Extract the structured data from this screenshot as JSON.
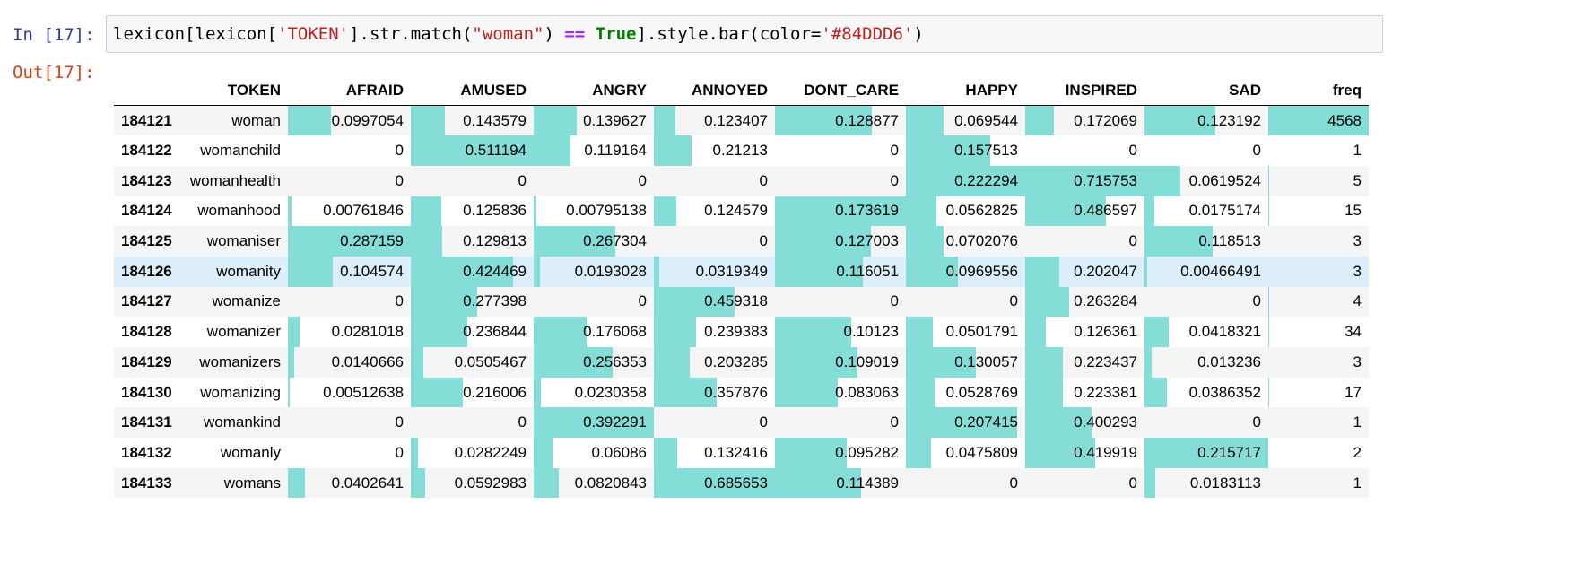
{
  "prompt_in": "In [17]:",
  "prompt_out": "Out[17]:",
  "code": {
    "p1": "lexicon[lexicon[",
    "s1": "'TOKEN'",
    "p2": "].str.match(",
    "s2": "\"woman\"",
    "p3": ") ",
    "op": "==",
    "p4": " ",
    "kw": "True",
    "p5": "].style.bar(color=",
    "s3": "'#84DDD6'",
    "p6": ")"
  },
  "bar_color": "#84DDD6",
  "highlight_row_index": 5,
  "table": {
    "columns": [
      "TOKEN",
      "AFRAID",
      "AMUSED",
      "ANGRY",
      "ANNOYED",
      "DONT_CARE",
      "HAPPY",
      "INSPIRED",
      "SAD",
      "freq"
    ],
    "rows": [
      {
        "index": "184121",
        "values": [
          "woman",
          "0.0997054",
          "0.143579",
          "0.139627",
          "0.123407",
          "0.128877",
          "0.069544",
          "0.172069",
          "0.123192",
          "4568"
        ]
      },
      {
        "index": "184122",
        "values": [
          "womanchild",
          "0",
          "0.511194",
          "0.119164",
          "0.21213",
          "0",
          "0.157513",
          "0",
          "0",
          "1"
        ]
      },
      {
        "index": "184123",
        "values": [
          "womanhealth",
          "0",
          "0",
          "0",
          "0",
          "0",
          "0.222294",
          "0.715753",
          "0.0619524",
          "5"
        ]
      },
      {
        "index": "184124",
        "values": [
          "womanhood",
          "0.00761846",
          "0.125836",
          "0.00795138",
          "0.124579",
          "0.173619",
          "0.0562825",
          "0.486597",
          "0.0175174",
          "15"
        ]
      },
      {
        "index": "184125",
        "values": [
          "womaniser",
          "0.287159",
          "0.129813",
          "0.267304",
          "0",
          "0.127003",
          "0.0702076",
          "0",
          "0.118513",
          "3"
        ]
      },
      {
        "index": "184126",
        "values": [
          "womanity",
          "0.104574",
          "0.424469",
          "0.0193028",
          "0.0319349",
          "0.116051",
          "0.0969556",
          "0.202047",
          "0.00466491",
          "3"
        ]
      },
      {
        "index": "184127",
        "values": [
          "womanize",
          "0",
          "0.277398",
          "0",
          "0.459318",
          "0",
          "0",
          "0.263284",
          "0",
          "4"
        ]
      },
      {
        "index": "184128",
        "values": [
          "womanizer",
          "0.0281018",
          "0.236844",
          "0.176068",
          "0.239383",
          "0.10123",
          "0.0501791",
          "0.126361",
          "0.0418321",
          "34"
        ]
      },
      {
        "index": "184129",
        "values": [
          "womanizers",
          "0.0140666",
          "0.0505467",
          "0.256353",
          "0.203285",
          "0.109019",
          "0.130057",
          "0.223437",
          "0.013236",
          "3"
        ]
      },
      {
        "index": "184130",
        "values": [
          "womanizing",
          "0.00512638",
          "0.216006",
          "0.0230358",
          "0.357876",
          "0.083063",
          "0.0528769",
          "0.223381",
          "0.0386352",
          "17"
        ]
      },
      {
        "index": "184131",
        "values": [
          "womankind",
          "0",
          "0",
          "0.392291",
          "0",
          "0",
          "0.207415",
          "0.400293",
          "0",
          "1"
        ]
      },
      {
        "index": "184132",
        "values": [
          "womanly",
          "0",
          "0.0282249",
          "0.06086",
          "0.132416",
          "0.095282",
          "0.0475809",
          "0.419919",
          "0.215717",
          "2"
        ]
      },
      {
        "index": "184133",
        "values": [
          "womans",
          "0.0402641",
          "0.0592983",
          "0.0820843",
          "0.685653",
          "0.114389",
          "0",
          "0",
          "0.0183113",
          "1"
        ]
      }
    ]
  }
}
